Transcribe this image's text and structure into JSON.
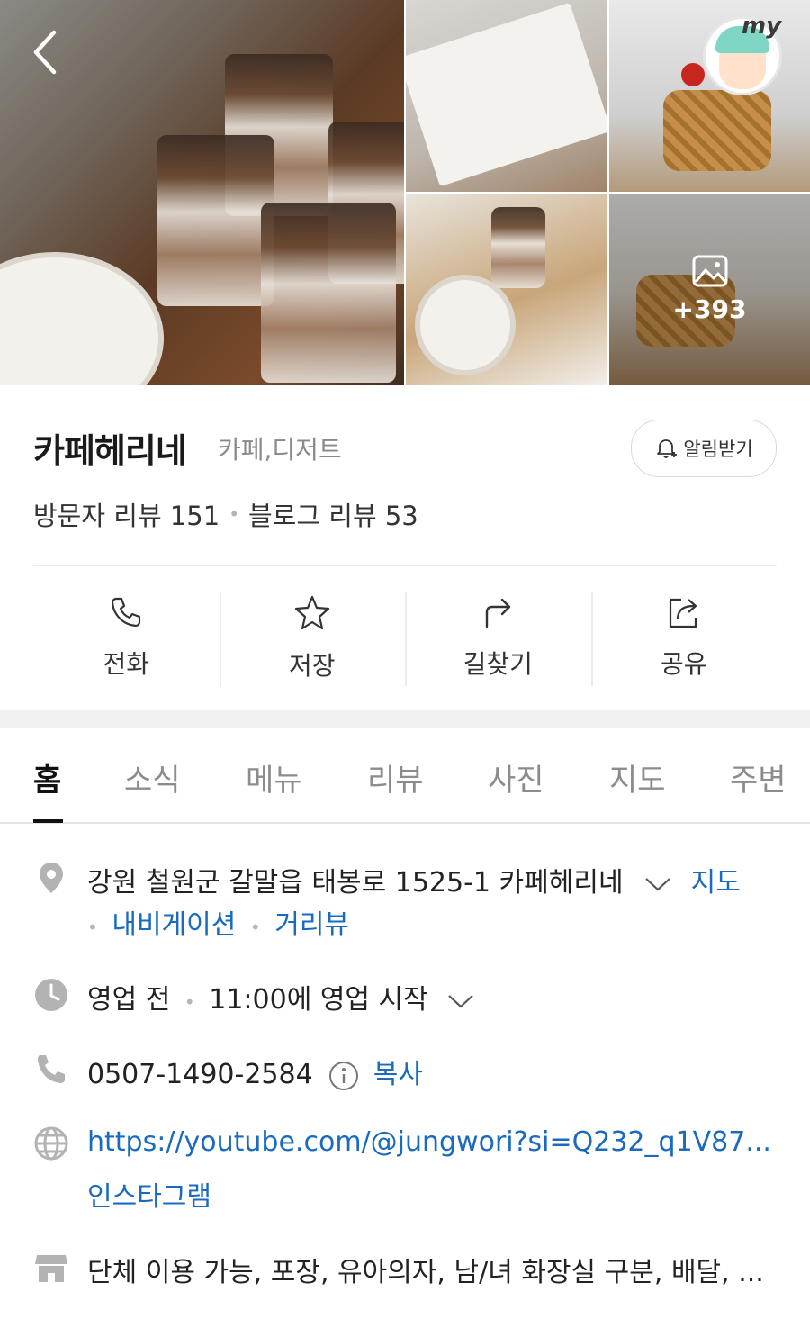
{
  "header": {
    "more_photos_count": "+393",
    "avatar_badge": "my"
  },
  "place": {
    "name": "카페헤리네",
    "category": "카페,디저트",
    "alarm_label": "알림받기",
    "visitor_reviews": "방문자 리뷰 151",
    "blog_reviews": "블로그 리뷰 53"
  },
  "actions": [
    {
      "label": "전화",
      "icon": "phone-icon"
    },
    {
      "label": "저장",
      "icon": "star-icon"
    },
    {
      "label": "길찾기",
      "icon": "directions-icon"
    },
    {
      "label": "공유",
      "icon": "share-icon"
    }
  ],
  "tabs": [
    "홈",
    "소식",
    "메뉴",
    "리뷰",
    "사진",
    "지도",
    "주변"
  ],
  "info": {
    "address": "강원 철원군 갈말읍 태봉로 1525-1 카페헤리네",
    "map_link": "지도",
    "navigation_link": "내비게이션",
    "street_view_link": "거리뷰",
    "hours_status": "영업 전",
    "hours_detail": "11:00에 영업 시작",
    "phone": "0507-1490-2584",
    "copy_label": "복사",
    "website": "https://youtube.com/@jungwori?si=Q232_q1V87...",
    "instagram": "인스타그램",
    "amenities": "단체 이용 가능, 포장, 유아의자, 남/녀 화장실 구분, 배달, ..."
  },
  "colors": {
    "link": "#1a6bbf",
    "icon_gray": "#b3b3b3"
  }
}
